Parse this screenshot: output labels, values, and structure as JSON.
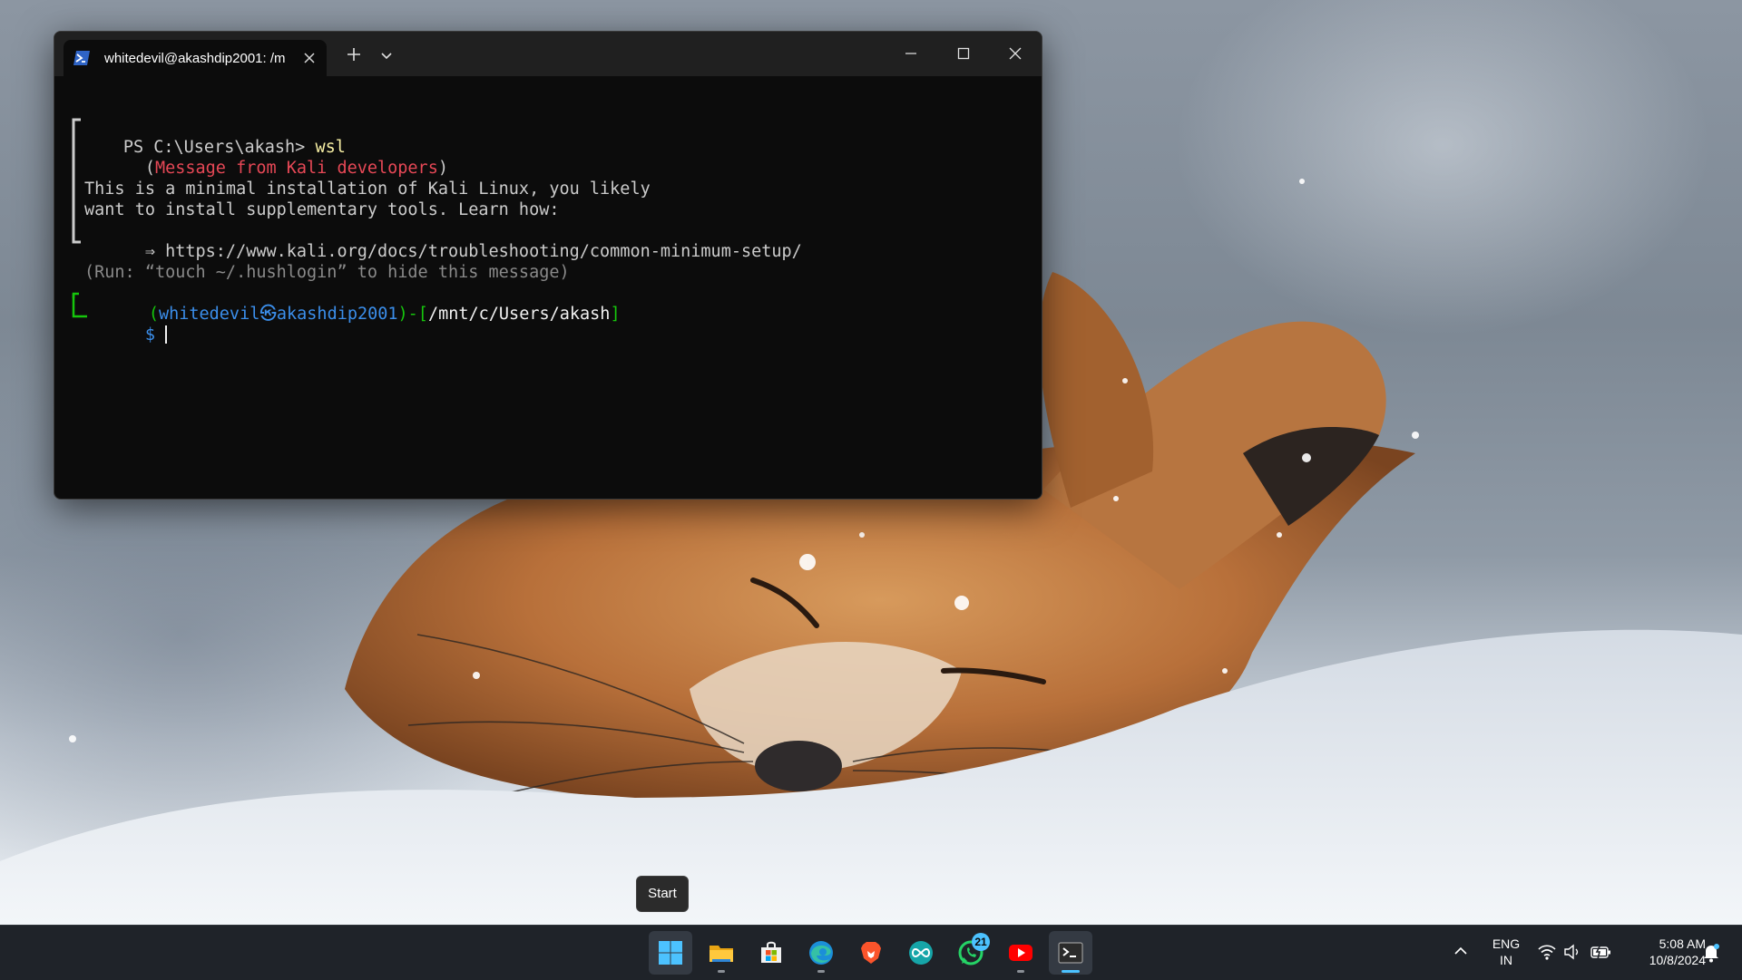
{
  "terminal": {
    "tab_title": "whitedevil@akashdip2001: /m",
    "lines": {
      "ps_prompt": "PS C:\\Users\\akash> ",
      "ps_command": "wsl",
      "msg_header": "Message from Kali developers",
      "info_1": "This is a minimal installation of Kali Linux, you likely",
      "info_2": "want to install supplementary tools. Learn how:",
      "info_3_arrow": "⇒",
      "info_3_url": "https://www.kali.org/docs/troubleshooting/common-minimum-setup/",
      "run_hint": "(Run: “touch ~/.hushlogin” to hide this message)",
      "user": "whitedevil",
      "at_symbol": "㉿",
      "host": "akashdip2001",
      "cwd": "/mnt/c/Users/akash",
      "prompt_symbol": "$"
    }
  },
  "tooltip": {
    "start": "Start"
  },
  "taskbar": {
    "apps": [
      "start",
      "file-explorer",
      "microsoft-store",
      "edge",
      "brave",
      "arduino",
      "whatsapp",
      "youtube",
      "terminal"
    ],
    "whatsapp_badge": "21"
  },
  "tray": {
    "lang_1": "ENG",
    "lang_2": "IN",
    "time": "5:08 AM",
    "date": "10/8/2024"
  },
  "colors": {
    "terminal_bg": "#0c0c0c",
    "titlebar_bg": "#202020",
    "kali_red": "#e74856",
    "kali_blue": "#3b8eea",
    "kali_green": "#16c60c",
    "accent": "#4cc2ff"
  }
}
